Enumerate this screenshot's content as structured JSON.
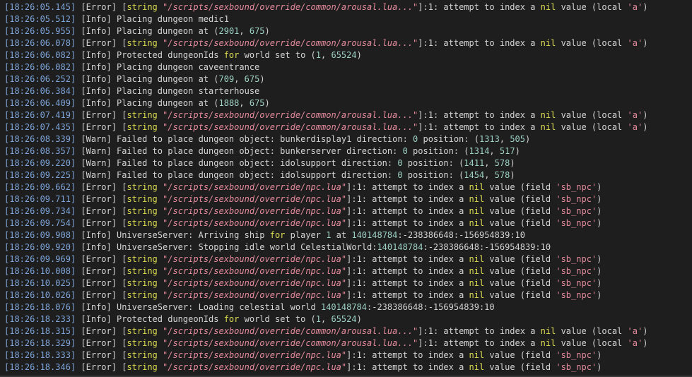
{
  "lines": [
    {
      "time": "[18:26:05.145]",
      "level": "[Error]",
      "msg": {
        "kind": "script",
        "path": "\"/scripts/sexbound/override/common/arousal.lua...\"",
        "loc": "]:1: attempt to index a ",
        "nil": "nil",
        "tail": " value (local ",
        "q": "'a'",
        "end": ")"
      }
    },
    {
      "time": "[18:26:05.512]",
      "level": "[Info]",
      "msg": {
        "kind": "plain",
        "text": "Placing dungeon medic1"
      }
    },
    {
      "time": "[18:26:05.955]",
      "level": "[Info]",
      "msg": {
        "kind": "coords",
        "text": "Placing dungeon at ",
        "a": "2901",
        "b": "675"
      }
    },
    {
      "time": "[18:26:06.078]",
      "level": "[Error]",
      "msg": {
        "kind": "script",
        "path": "\"/scripts/sexbound/override/common/arousal.lua...\"",
        "loc": "]:1: attempt to index a ",
        "nil": "nil",
        "tail": " value (local ",
        "q": "'a'",
        "end": ")"
      }
    },
    {
      "time": "[18:26:06.082]",
      "level": "[Info]",
      "msg": {
        "kind": "world",
        "text": "Protected dungeonIds ",
        "kw": "for",
        "rest": " world set to ",
        "a": "1",
        "b": "65524"
      }
    },
    {
      "time": "[18:26:06.082]",
      "level": "[Info]",
      "msg": {
        "kind": "plain",
        "text": "Placing dungeon caveentrance"
      }
    },
    {
      "time": "[18:26:06.252]",
      "level": "[Info]",
      "msg": {
        "kind": "coords",
        "text": "Placing dungeon at ",
        "a": "709",
        "b": "675"
      }
    },
    {
      "time": "[18:26:06.384]",
      "level": "[Info]",
      "msg": {
        "kind": "plain",
        "text": "Placing dungeon starterhouse"
      }
    },
    {
      "time": "[18:26:06.409]",
      "level": "[Info]",
      "msg": {
        "kind": "coords",
        "text": "Placing dungeon at ",
        "a": "1888",
        "b": "675"
      }
    },
    {
      "time": "[18:26:07.419]",
      "level": "[Error]",
      "msg": {
        "kind": "script",
        "path": "\"/scripts/sexbound/override/common/arousal.lua...\"",
        "loc": "]:1: attempt to index a ",
        "nil": "nil",
        "tail": " value (local ",
        "q": "'a'",
        "end": ")"
      }
    },
    {
      "time": "[18:26:07.435]",
      "level": "[Error]",
      "msg": {
        "kind": "script",
        "path": "\"/scripts/sexbound/override/common/arousal.lua...\"",
        "loc": "]:1: attempt to index a ",
        "nil": "nil",
        "tail": " value (local ",
        "q": "'a'",
        "end": ")"
      }
    },
    {
      "time": "[18:26:08.339]",
      "level": "[Warn]",
      "msg": {
        "kind": "warn",
        "text": "Failed to place dungeon object: bunkerdisplay1 direction: ",
        "d": "0",
        "p": " position: ",
        "a": "1313",
        "b": "505"
      }
    },
    {
      "time": "[18:26:08.357]",
      "level": "[Warn]",
      "msg": {
        "kind": "warn",
        "text": "Failed to place dungeon object: bunkerserver direction: ",
        "d": "0",
        "p": " position: ",
        "a": "1314",
        "b": "517"
      }
    },
    {
      "time": "[18:26:09.220]",
      "level": "[Warn]",
      "msg": {
        "kind": "warn",
        "text": "Failed to place dungeon object: idolsupport direction: ",
        "d": "0",
        "p": " position: ",
        "a": "1411",
        "b": "578"
      }
    },
    {
      "time": "[18:26:09.225]",
      "level": "[Warn]",
      "msg": {
        "kind": "warn",
        "text": "Failed to place dungeon object: idolsupport direction: ",
        "d": "0",
        "p": " position: ",
        "a": "1454",
        "b": "578"
      }
    },
    {
      "time": "[18:26:09.662]",
      "level": "[Error]",
      "msg": {
        "kind": "script",
        "path": "\"/scripts/sexbound/override/npc.lua\"",
        "loc": "]:1: attempt to index a ",
        "nil": "nil",
        "tail": " value (field ",
        "q": "'sb_npc'",
        "end": ")"
      }
    },
    {
      "time": "[18:26:09.711]",
      "level": "[Error]",
      "msg": {
        "kind": "script",
        "path": "\"/scripts/sexbound/override/npc.lua\"",
        "loc": "]:1: attempt to index a ",
        "nil": "nil",
        "tail": " value (field ",
        "q": "'sb_npc'",
        "end": ")"
      }
    },
    {
      "time": "[18:26:09.734]",
      "level": "[Error]",
      "msg": {
        "kind": "script",
        "path": "\"/scripts/sexbound/override/npc.lua\"",
        "loc": "]:1: attempt to index a ",
        "nil": "nil",
        "tail": " value (field ",
        "q": "'sb_npc'",
        "end": ")"
      }
    },
    {
      "time": "[18:26:09.754]",
      "level": "[Error]",
      "msg": {
        "kind": "script",
        "path": "\"/scripts/sexbound/override/npc.lua\"",
        "loc": "]:1: attempt to index a ",
        "nil": "nil",
        "tail": " value (field ",
        "q": "'sb_npc'",
        "end": ")"
      }
    },
    {
      "time": "[18:26:09.908]",
      "level": "[Info]",
      "msg": {
        "kind": "ship",
        "text": "UniverseServer: Arriving ship ",
        "kw": "for",
        "rest": " player ",
        "n": "1",
        "at": " at ",
        "c1": "140148784",
        "c2": ":-238386648:-156954839:10"
      }
    },
    {
      "time": "[18:26:09.920]",
      "level": "[Info]",
      "msg": {
        "kind": "idle",
        "text": "UniverseServer: Stopping idle world CelestialWorld:",
        "c1": "140148784",
        "c2": ":-238386648:-156954839:10"
      }
    },
    {
      "time": "[18:26:09.969]",
      "level": "[Error]",
      "msg": {
        "kind": "script",
        "path": "\"/scripts/sexbound/override/npc.lua\"",
        "loc": "]:1: attempt to index a ",
        "nil": "nil",
        "tail": " value (field ",
        "q": "'sb_npc'",
        "end": ")"
      }
    },
    {
      "time": "[18:26:10.008]",
      "level": "[Error]",
      "msg": {
        "kind": "script",
        "path": "\"/scripts/sexbound/override/npc.lua\"",
        "loc": "]:1: attempt to index a ",
        "nil": "nil",
        "tail": " value (field ",
        "q": "'sb_npc'",
        "end": ")"
      }
    },
    {
      "time": "[18:26:10.025]",
      "level": "[Error]",
      "msg": {
        "kind": "script",
        "path": "\"/scripts/sexbound/override/npc.lua\"",
        "loc": "]:1: attempt to index a ",
        "nil": "nil",
        "tail": " value (field ",
        "q": "'sb_npc'",
        "end": ")"
      }
    },
    {
      "time": "[18:26:10.026]",
      "level": "[Error]",
      "msg": {
        "kind": "script",
        "path": "\"/scripts/sexbound/override/npc.lua\"",
        "loc": "]:1: attempt to index a ",
        "nil": "nil",
        "tail": " value (field ",
        "q": "'sb_npc'",
        "end": ")"
      }
    },
    {
      "time": "[18:26:18.076]",
      "level": "[Info]",
      "msg": {
        "kind": "idle",
        "text": "UniverseServer: Loading celestial world ",
        "c1": "140148784",
        "c2": ":-238386648:-156954839:10"
      }
    },
    {
      "time": "[18:26:18.233]",
      "level": "[Info]",
      "msg": {
        "kind": "world",
        "text": "Protected dungeonIds ",
        "kw": "for",
        "rest": " world set to ",
        "a": "1",
        "b": "65524"
      }
    },
    {
      "time": "[18:26:18.315]",
      "level": "[Error]",
      "msg": {
        "kind": "script",
        "path": "\"/scripts/sexbound/override/common/arousal.lua...\"",
        "loc": "]:1: attempt to index a ",
        "nil": "nil",
        "tail": " value (local ",
        "q": "'a'",
        "end": ")"
      }
    },
    {
      "time": "[18:26:18.329]",
      "level": "[Error]",
      "msg": {
        "kind": "script",
        "path": "\"/scripts/sexbound/override/common/arousal.lua...\"",
        "loc": "]:1: attempt to index a ",
        "nil": "nil",
        "tail": " value (local ",
        "q": "'a'",
        "end": ")"
      }
    },
    {
      "time": "[18:26:18.333]",
      "level": "[Error]",
      "msg": {
        "kind": "script",
        "path": "\"/scripts/sexbound/override/npc.lua\"",
        "loc": "]:1: attempt to index a ",
        "nil": "nil",
        "tail": " value (field ",
        "q": "'sb_npc'",
        "end": ")"
      }
    },
    {
      "time": "[18:26:18.346]",
      "level": "[Error]",
      "msg": {
        "kind": "script",
        "path": "\"/scripts/sexbound/override/npc.lua\"",
        "loc": "]:1: attempt to index a ",
        "nil": "nil",
        "tail": " value (field ",
        "q": "'sb_npc'",
        "end": ")"
      }
    }
  ],
  "tokens": {
    "string_kw": "string",
    "open_bracket": "[",
    "sep": " "
  }
}
